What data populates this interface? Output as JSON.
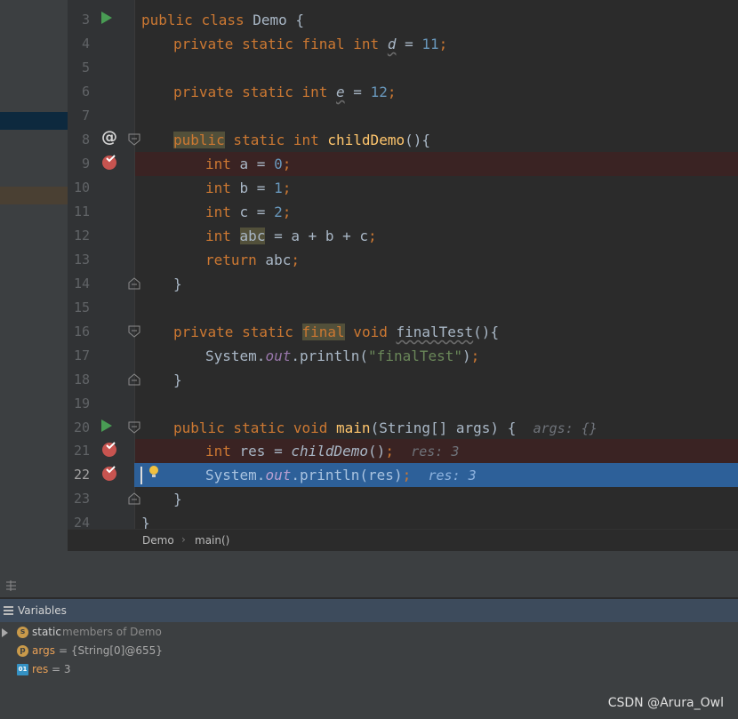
{
  "editor": {
    "line_numbers": [
      "3",
      "4",
      "5",
      "6",
      "7",
      "8",
      "9",
      "10",
      "11",
      "12",
      "13",
      "14",
      "15",
      "16",
      "17",
      "18",
      "19",
      "20",
      "21",
      "22",
      "23",
      "24"
    ],
    "code": {
      "l3": {
        "kw_public": "public",
        "kw_class": "class",
        "name": "Demo",
        "brace": " {"
      },
      "l4": {
        "mods": "private static final int ",
        "var": "d",
        "eq": " = ",
        "num": "11",
        "semi": ";"
      },
      "l6": {
        "mods": "private static int ",
        "var": "e",
        "eq": " = ",
        "num": "12",
        "semi": ";"
      },
      "l8": {
        "kw_public": "public",
        "mods": " static int ",
        "fn": "childDemo",
        "tail": "(){"
      },
      "l9": {
        "kw": "int",
        "rest": " a = ",
        "num": "0",
        "semi": ";"
      },
      "l10": {
        "kw": "int",
        "rest": " b = ",
        "num": "1",
        "semi": ";"
      },
      "l11": {
        "kw": "int",
        "rest": " c = ",
        "num": "2",
        "semi": ";"
      },
      "l12": {
        "kw": "int",
        "sp": " ",
        "var": "abc",
        "rest": " = a + b + c",
        "semi": ";"
      },
      "l13": {
        "kw": "return",
        "rest": " abc",
        "semi": ";"
      },
      "l14": {
        "text": "}"
      },
      "l16": {
        "mods1": "private static ",
        "kw_final": "final",
        "mods2": " void ",
        "fn": "finalTest",
        "tail": "(){"
      },
      "l17": {
        "obj": "System.",
        "field": "out",
        "call": ".println(",
        "str": "\"finalTest\"",
        "tail": ")",
        "semi": ";"
      },
      "l18": {
        "text": "}"
      },
      "l20": {
        "mods": "public static void ",
        "fn": "main",
        "tail": "(String[] args) {",
        "inlay": "args: {}"
      },
      "l21": {
        "kw": "int",
        "rest": " res = ",
        "call": "childDemo",
        "tail": "()",
        "semi": ";",
        "inlay": "res: 3"
      },
      "l22": {
        "obj": "System.",
        "field": "out",
        "call": ".println(res)",
        "semi": ";",
        "inlay": "res: 3"
      },
      "l23": {
        "text": "}"
      },
      "l24": {
        "text": "}"
      }
    }
  },
  "breadcrumb": {
    "items": [
      "Demo",
      "main()"
    ],
    "separator": "›"
  },
  "variables_panel": {
    "title": "Variables",
    "rows": [
      {
        "badge": "s",
        "badge_color": "#c99a4a",
        "name": "static",
        "value": "members of Demo",
        "expandable": true
      },
      {
        "badge": "p",
        "badge_color": "#c99a4a",
        "name": "args",
        "value": "= {String[0]@655}",
        "expandable": false
      },
      {
        "badge": "01",
        "badge_color": "#3592c4",
        "name": "res",
        "value": "= 3",
        "expandable": false
      }
    ]
  },
  "watermark": "CSDN @Arura_Owl",
  "colors": {
    "keyword": "#cc7832",
    "number": "#6897bb",
    "string": "#6a8759",
    "field": "#9876aa",
    "method_decl": "#ffc66d",
    "breakpoint_line": "#3a2323",
    "execution_line": "#2d6099",
    "breakpoint": "#c75450",
    "run_icon": "#499c54"
  },
  "icons": {
    "run": "run-gutter-icon",
    "breakpoint": "breakpoint-verified-icon",
    "override": "at-override-icon",
    "bulb": "intention-bulb-icon",
    "fold": "fold-marker-icon"
  }
}
